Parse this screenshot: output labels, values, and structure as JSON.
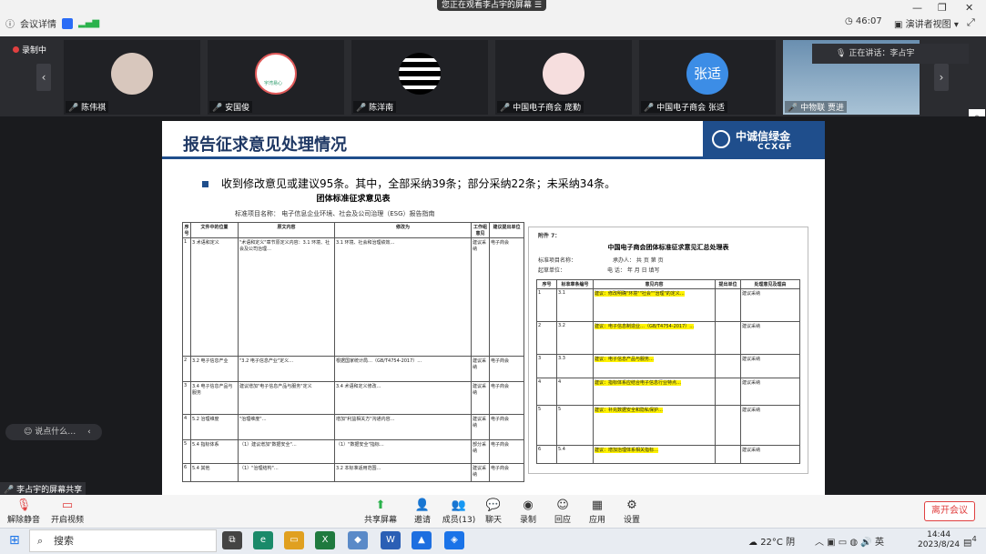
{
  "top": {
    "sharing_banner": "您正在观看李占宇的屏幕",
    "meeting_details": "会议详情",
    "timer": "46:07",
    "speaker_view": "演讲者视图",
    "minimize": "—",
    "restore": "❐",
    "close": "✕",
    "recording": "录制中"
  },
  "participants": [
    {
      "name": "陈伟祺"
    },
    {
      "name": "安国俊"
    },
    {
      "name": "陈洋南"
    },
    {
      "name": "中国电子商会 庞勤"
    },
    {
      "name": "中国电子商会 张适",
      "avatar_text": "张适"
    },
    {
      "name": "中物联 贾进"
    }
  ],
  "avatar_caption_2": "宇湾易心",
  "speaking": "正在讲话：李占宇",
  "slide": {
    "title": "报告征求意见处理情况",
    "logo_cn": "中诚信绿金",
    "logo_en": "CCXGF",
    "bullet": "收到修改意见或建议95条。其中，全部采纳39条；部分采纳22条；未采纳34条。"
  },
  "left_doc": {
    "title": "团体标准征求意见表",
    "project": "标准项目名称：  电子信息企业环境、社会及公司治理（ESG）报告指南",
    "headers": [
      "序号",
      "文件中的位置",
      "原文内容",
      "修改为",
      "工作组意见",
      "建议提出单位"
    ],
    "rows": [
      {
        "no": "1",
        "pos": "3 术语和定义",
        "orig": "\"术语和定义\"章节原定义内容：3.1 环境、社会及公司治理…",
        "mod": "3.1 环境、社会和治理绩效…",
        "opinion": "建议采纳",
        "unit": "电子商会"
      },
      {
        "no": "2",
        "pos": "3.2 电子信息产业",
        "orig": "\"3.2 电子信息产业\"定义…",
        "mod": "根据国家统计局…（GB/T4754-2017）…",
        "opinion": "建议采纳",
        "unit": "电子商会"
      },
      {
        "no": "3",
        "pos": "3.4 电子信息产品与服务",
        "orig": "建议增加\"电子信息产品与服务\"定义",
        "mod": "3.4 术语和定义修改…",
        "opinion": "建议采纳",
        "unit": "电子商会"
      },
      {
        "no": "4",
        "pos": "5.2 治理维度",
        "orig": "\"治理维度\"…",
        "mod": "增加\"利益相关方\"沟通内容…",
        "opinion": "建议采纳",
        "unit": "电子商会"
      },
      {
        "no": "5",
        "pos": "5.4 指标体系",
        "orig": "（1）建议增加\"数据安全\"…",
        "mod": "（1）\"数据安全\"指标…",
        "opinion": "部分采纳",
        "unit": "电子商会"
      },
      {
        "no": "6",
        "pos": "5.4 其他",
        "orig": "（1）\"治理结构\"…",
        "mod": "3.2 本标准适用范围…",
        "opinion": "建议采纳",
        "unit": "电子商会"
      }
    ]
  },
  "right_doc": {
    "tag": "附件 7：",
    "title": "中国电子商会团体标准征求意见汇总处理表",
    "meta1": "标准项目名称：",
    "meta2": "承办人：      共    页   第    页",
    "meta3": "起草单位：",
    "meta4": "电   话：      年    月    日 填写",
    "headers": [
      "序号",
      "标准章条编号",
      "意见内容",
      "提出单位",
      "处理意见及理由"
    ],
    "rows": [
      {
        "no": "1",
        "clause": "3.1",
        "content": "建议：修改明确\"环境\"\"社会\"\"治理\"的定义…",
        "result": "建议采纳"
      },
      {
        "no": "2",
        "clause": "3.2",
        "content": "建议：电子信息制造业…（GB/T4754-2017）…",
        "result": "建议采纳"
      },
      {
        "no": "3",
        "clause": "3.3",
        "content": "建议：电子信息产品与服务…",
        "result": "建议采纳"
      },
      {
        "no": "4",
        "clause": "4",
        "content": "建议：指标体系应结合电子信息行业特点…",
        "result": "建议采纳"
      },
      {
        "no": "5",
        "clause": "5",
        "content": "建议：补充数据安全和隐私保护…",
        "result": "建议采纳"
      },
      {
        "no": "6",
        "clause": "5.4",
        "content": "建议：增加治理体系相关指标…",
        "result": "建议采纳"
      }
    ]
  },
  "chat_placeholder": "说点什么…",
  "sharer": "李占宇的屏幕共享",
  "toolbar": {
    "unmute": "解除静音",
    "video": "开启视频",
    "share": "共享屏幕",
    "invite": "邀请",
    "members": "成员(13)",
    "chat": "聊天",
    "record": "录制",
    "react": "回应",
    "apps": "应用",
    "settings": "设置",
    "leave": "离开会议"
  },
  "taskbar": {
    "search": "搜索",
    "weather": "22°C 阴",
    "lang": "英",
    "time": "14:44",
    "date": "2023/8/24",
    "notif": "4"
  }
}
